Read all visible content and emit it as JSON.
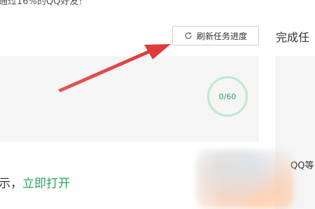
{
  "header": {
    "top_text": "通过16%的QQ好友!"
  },
  "toolbar": {
    "refresh_label": "刷新任务进度"
  },
  "right": {
    "heading": "完成任",
    "side_text": "QQ等"
  },
  "task": {
    "progress_text": "0/60",
    "progress_value": 0,
    "progress_total": 60
  },
  "bottom": {
    "prefix": "示，",
    "link": "立即打开"
  },
  "colors": {
    "accent_green": "#2aa55a",
    "progress_ring": "#bfe8cf",
    "arrow_red": "#e03b3b"
  },
  "icons": {
    "refresh": "refresh-icon"
  }
}
